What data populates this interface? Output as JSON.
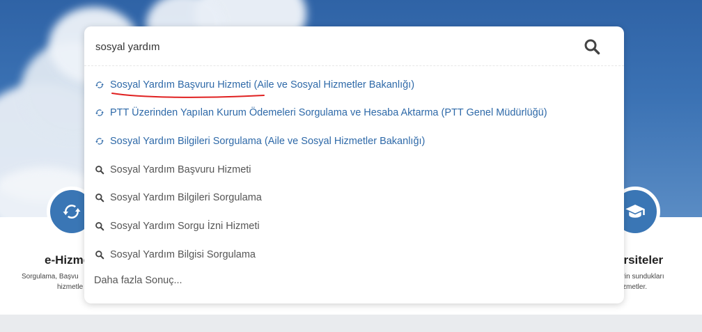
{
  "search": {
    "value": "sosyal yardım",
    "button_icon": "search-icon"
  },
  "suggestions": [
    {
      "type": "service",
      "icon": "refresh-icon",
      "label": "Sosyal Yardım Başvuru Hizmeti (Aile ve Sosyal Hizmetler Bakanlığı)"
    },
    {
      "type": "service",
      "icon": "refresh-icon",
      "label": "PTT Üzerinden Yapılan Kurum Ödemeleri Sorgulama ve Hesaba Aktarma (PTT Genel Müdürlüğü)"
    },
    {
      "type": "service",
      "icon": "refresh-icon",
      "label": "Sosyal Yardım Bilgileri Sorgulama (Aile ve Sosyal Hizmetler Bakanlığı)"
    },
    {
      "type": "query",
      "icon": "search-icon",
      "label": "Sosyal Yardım Başvuru Hizmeti"
    },
    {
      "type": "query",
      "icon": "search-icon",
      "label": "Sosyal Yardım Bilgileri Sorgulama"
    },
    {
      "type": "query",
      "icon": "search-icon",
      "label": "Sosyal Yardım Sorgu İzni Hizmeti"
    },
    {
      "type": "query",
      "icon": "search-icon",
      "label": "Sosyal Yardım Bilgisi Sorgulama"
    }
  ],
  "more_results": "Daha fazla Sonuç...",
  "background": {
    "left_service": {
      "title": "e-Hizme",
      "desc_line1": "Sorgulama, Başvu",
      "desc_line2": "hizmetle"
    },
    "right_service": {
      "title": "ersiteler",
      "desc_line1": "erin sundukları",
      "desc_line2": "zmetler."
    }
  },
  "colors": {
    "accent": "#2e69a8",
    "circle": "#3a76b5",
    "annotation": "#e02020"
  }
}
